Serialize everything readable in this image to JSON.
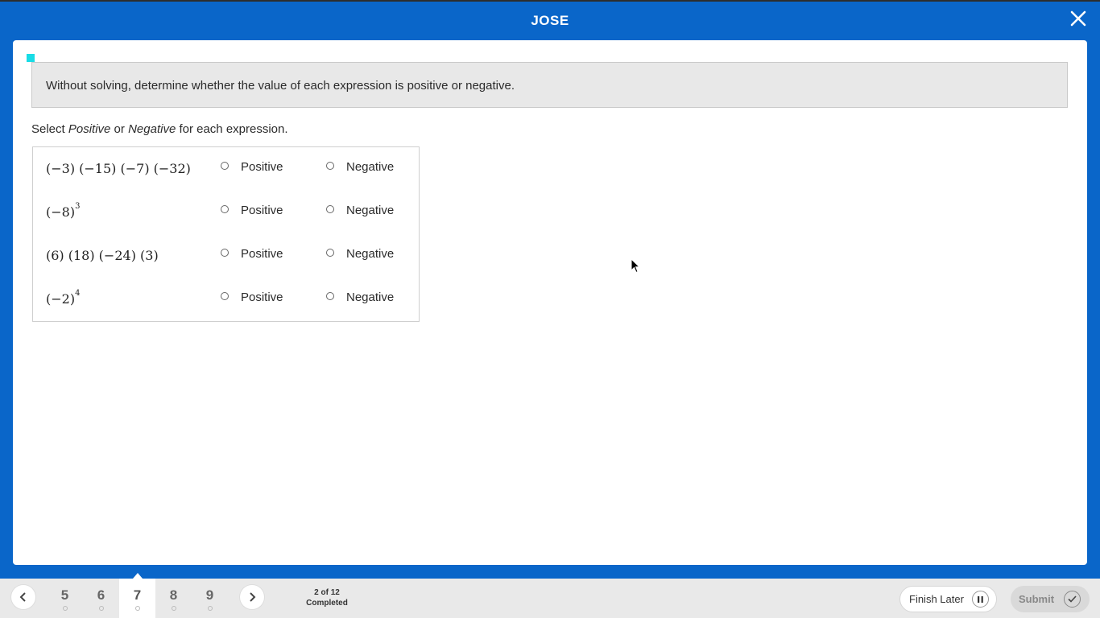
{
  "header": {
    "title": "JOSE"
  },
  "question": {
    "prompt": "Without solving, determine whether the value of each expression is positive or negative.",
    "instruction_prefix": "Select ",
    "instruction_opt1": "Positive",
    "instruction_or": " or ",
    "instruction_opt2": "Negative",
    "instruction_suffix": " for each expression.",
    "rows": [
      {
        "expr": "(−3) (−15) (−7) (−32)",
        "exponent": "",
        "positive_label": "Positive",
        "negative_label": "Negative"
      },
      {
        "expr": "(−8)",
        "exponent": "3",
        "positive_label": "Positive",
        "negative_label": "Negative"
      },
      {
        "expr": "(6) (18) (−24) (3)",
        "exponent": "",
        "positive_label": "Positive",
        "negative_label": "Negative"
      },
      {
        "expr": "(−2)",
        "exponent": "4",
        "positive_label": "Positive",
        "negative_label": "Negative"
      }
    ]
  },
  "footer": {
    "questions": [
      "5",
      "6",
      "7",
      "8",
      "9"
    ],
    "active_question": "7",
    "progress_line1": "2 of 12",
    "progress_line2": "Completed",
    "finish_later_label": "Finish Later",
    "submit_label": "Submit"
  },
  "colors": {
    "brand": "#0a66c9",
    "marker": "#18dce6"
  },
  "icons": [
    "close-icon",
    "chevron-left-icon",
    "chevron-right-icon",
    "pause-icon",
    "check-icon",
    "cursor-icon"
  ]
}
